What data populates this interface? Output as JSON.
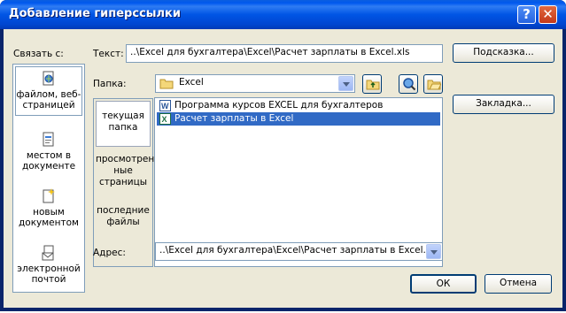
{
  "window": {
    "title": "Добавление гиперссылки",
    "help_label": "?",
    "close_label": "✕"
  },
  "link_to": {
    "label": "Связать с:",
    "items": [
      {
        "label": "файлом, веб-страницей",
        "icon": "globe-document-icon",
        "selected": true
      },
      {
        "label": "местом в документе",
        "icon": "document-place-icon",
        "selected": false
      },
      {
        "label": "новым документом",
        "icon": "new-document-icon",
        "selected": false
      },
      {
        "label": "электронной почтой",
        "icon": "email-icon",
        "selected": false
      }
    ]
  },
  "text_field": {
    "label": "Текст:",
    "value": "..\\Excel для бухгалтера\\Excel\\Расчет зарплаты в Excel.xls"
  },
  "screentip_button": "Подсказка...",
  "folder": {
    "label": "Папка:",
    "value": "Excel",
    "icon": "folder-icon"
  },
  "toolbar_buttons": [
    {
      "name": "up-one-folder-icon"
    },
    {
      "name": "browse-web-icon"
    },
    {
      "name": "browse-file-icon"
    }
  ],
  "bookmark_button": "Закладка...",
  "nav": {
    "items": [
      {
        "label": "текущая папка",
        "selected": true
      },
      {
        "label": "просмотрен-ные страницы",
        "selected": false
      },
      {
        "label": "последние файлы",
        "selected": false
      }
    ]
  },
  "files": [
    {
      "name": "Программа курсов EXCEL для бухгалтеров",
      "icon": "word-file-icon",
      "selected": false
    },
    {
      "name": "Расчет зарплаты в Excel",
      "icon": "excel-file-icon",
      "selected": true
    }
  ],
  "address": {
    "label": "Адрес:",
    "value": "..\\Excel для бухгалтера\\Excel\\Расчет зарплаты в Excel.xls"
  },
  "ok_button": "ОК",
  "cancel_button": "Отмена"
}
